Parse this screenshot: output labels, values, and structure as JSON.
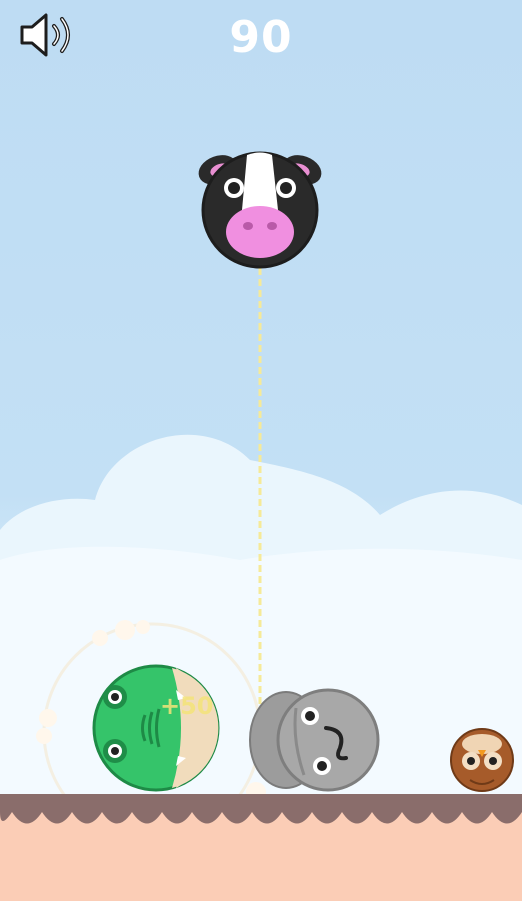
{
  "hud": {
    "score": "90",
    "sound": "on"
  },
  "popup": {
    "points": "+50"
  },
  "pieces": {
    "dropper": "cow",
    "board": [
      "frog",
      "elephant",
      "owl"
    ]
  },
  "colors": {
    "sky": "#bedcf3",
    "ground_top": "#8a6d6b",
    "ground_bottom": "#fbcdb6",
    "guide_line": "#f6ea98",
    "frog": "#35c46a",
    "elephant": "#a8a8a8",
    "owl": "#a65b2a"
  }
}
